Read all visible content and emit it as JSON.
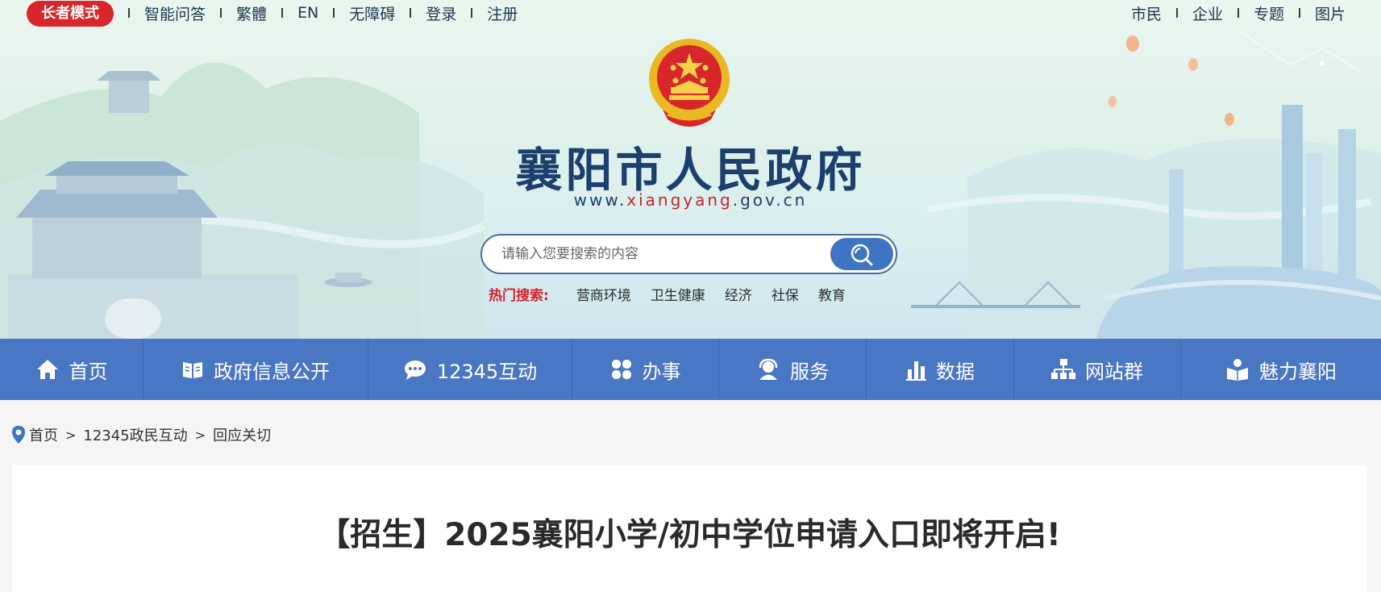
{
  "topbar": {
    "elder_mode": "长者模式",
    "left_links": [
      "智能问答",
      "繁體",
      "EN",
      "无障碍",
      "登录",
      "注册"
    ],
    "right_links": [
      "市民",
      "企业",
      "专题",
      "图片"
    ]
  },
  "header": {
    "site_title": "襄阳市人民政府",
    "url_prefix": "www.",
    "url_highlight": "xiangyang",
    "url_suffix": ".gov.cn"
  },
  "search": {
    "placeholder": "请输入您要搜索的内容",
    "hot_label": "热门搜索:",
    "hot_terms": [
      "营商环境",
      "卫生健康",
      "经济",
      "社保",
      "教育"
    ]
  },
  "nav": {
    "items": [
      {
        "label": "首页",
        "icon": "home-icon"
      },
      {
        "label": "政府信息公开",
        "icon": "book-icon"
      },
      {
        "label": "12345互动",
        "icon": "chat-icon"
      },
      {
        "label": "办事",
        "icon": "clover-icon"
      },
      {
        "label": "服务",
        "icon": "user-service-icon"
      },
      {
        "label": "数据",
        "icon": "bar-chart-icon"
      },
      {
        "label": "网站群",
        "icon": "sitemap-icon"
      },
      {
        "label": "魅力襄阳",
        "icon": "reader-icon"
      }
    ]
  },
  "breadcrumb": {
    "items": [
      "首页",
      "12345政民互动",
      "回应关切"
    ],
    "separator": ">"
  },
  "article": {
    "title": "【招生】2025襄阳小学/初中学位申请入口即将开启!"
  },
  "colors": {
    "brand_red": "#d8262b",
    "nav_blue": "#4a77c4",
    "title_navy": "#1c3f6e"
  }
}
